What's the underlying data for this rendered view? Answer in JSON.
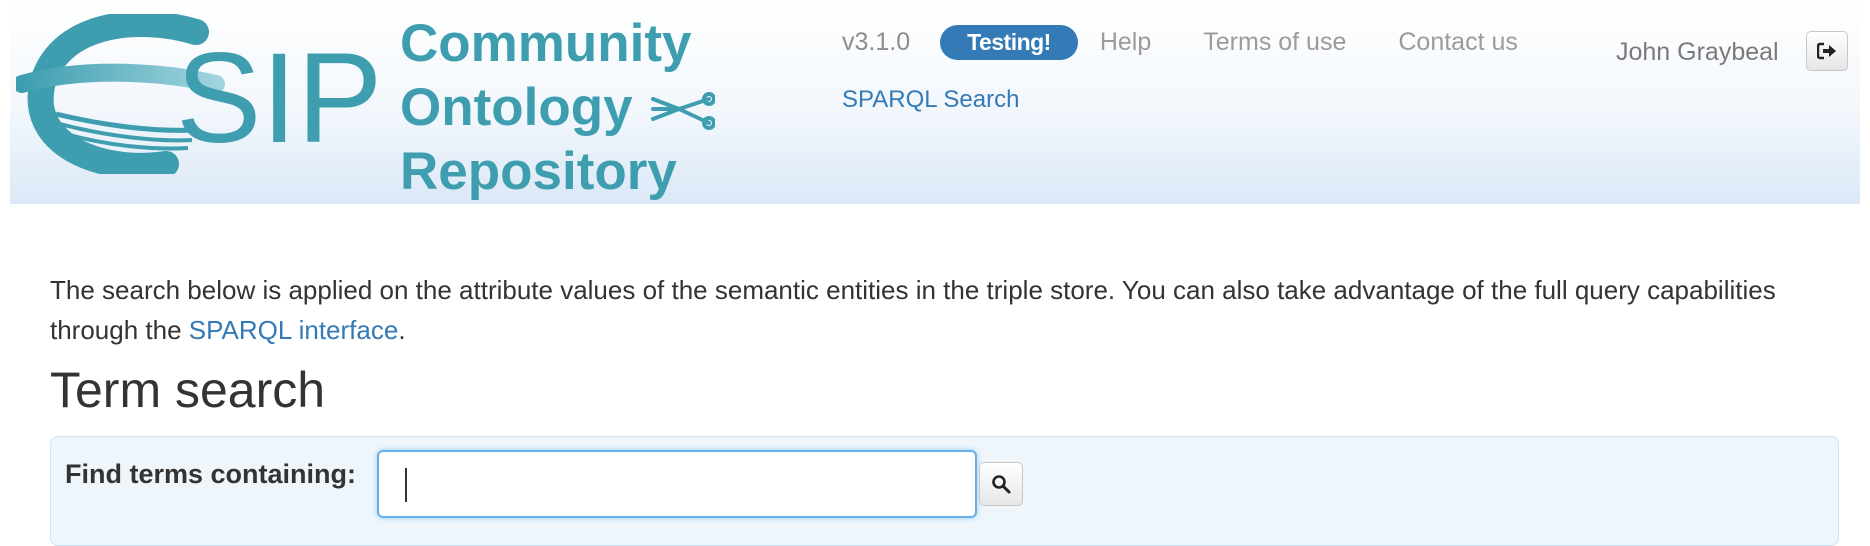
{
  "header": {
    "logo_text": "ESIP",
    "brand_lines": [
      "Community",
      "Ontology",
      "Repository"
    ],
    "brand_color": "#3e9eb0",
    "nav": {
      "version": "v3.1.0",
      "testing_badge": "Testing!",
      "help": "Help",
      "terms": "Terms of use",
      "contact": "Contact us",
      "sparql_search": "SPARQL Search"
    },
    "user_name": "John Graybeal",
    "logout_icon": "sign-out-icon"
  },
  "intro": {
    "text": "The search below is applied on the attribute values of the semantic entities in the triple store. You can also take advantage of the full query capabilities through the ",
    "link_text": "SPARQL interface",
    "suffix": "."
  },
  "page_title": "Term search",
  "search": {
    "label": "Find terms containing:",
    "value": "",
    "placeholder": "",
    "button_icon": "search-icon"
  },
  "colors": {
    "link": "#337ab7",
    "badge_bg": "#337ab7",
    "panel_bg": "#eef6fc"
  }
}
